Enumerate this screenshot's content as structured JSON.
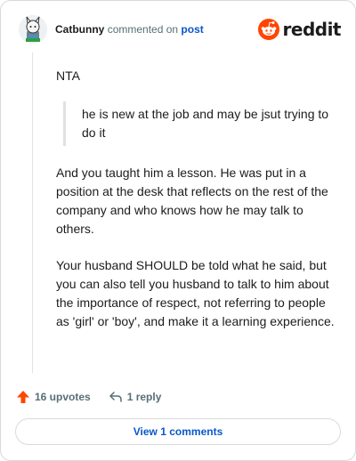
{
  "comment": {
    "author": "Catbunny",
    "action_text": "commented on",
    "target_link": "post",
    "paragraphs": {
      "first": "NTA",
      "quote": "he is new at the job and may be jsut trying to do it",
      "second": "And you taught him a lesson. He was put in a position at the desk that reflects on the rest of the company and who knows how he may talk to others.",
      "third": "Your husband SHOULD be told what he said, but you can also tell you husband to talk to him about the importance of respect, not referring to people as 'girl' or 'boy', and make it a learning experience."
    }
  },
  "brand": {
    "name": "reddit"
  },
  "actions": {
    "upvotes_label": "16 upvotes",
    "reply_label": "1 reply"
  },
  "view_comments_label": "View 1 comments",
  "colors": {
    "upvote": "#ff4500",
    "link": "#0a57c9",
    "reddit_orange": "#ff4500"
  },
  "icons": [
    "avatar",
    "reddit-logo-icon",
    "upvote-arrow-icon",
    "reply-arrow-icon"
  ]
}
